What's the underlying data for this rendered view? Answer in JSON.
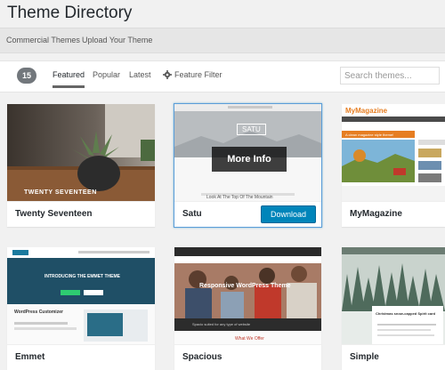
{
  "page": {
    "title": "Theme Directory"
  },
  "subnav": {
    "items": [
      "Commercial Themes",
      "Upload Your Theme"
    ]
  },
  "filter_bar": {
    "count": "15",
    "tabs": [
      {
        "label": "Featured",
        "active": true
      },
      {
        "label": "Popular",
        "active": false
      },
      {
        "label": "Latest",
        "active": false
      }
    ],
    "feature_filter": "Feature Filter",
    "search_placeholder": "Search themes..."
  },
  "themes": [
    {
      "name": "Twenty Seventeen",
      "screenshot_text": "TWENTY SEVENTEEN"
    },
    {
      "name": "Satu",
      "screenshot_title": "SATU",
      "screenshot_caption": "Look At The Top Of The Mountain",
      "more_info": "More Info",
      "download": "Download"
    },
    {
      "name": "MyMagazine",
      "screenshot_title": "MyMagazine",
      "screenshot_banner": "A clean magazine style theme!"
    },
    {
      "name": "Emmet",
      "screenshot_heading": "INTRODUCING THE EMMET THEME",
      "screenshot_sub": "WordPress Customizer"
    },
    {
      "name": "Spacious",
      "screenshot_heading": "Responsive WordPress Theme",
      "screenshot_sub": "Spacio suited for any type of website",
      "screenshot_footer": "What We Offer"
    },
    {
      "name": "Simple",
      "screenshot_text": "Christmas snow-capped Spirit card"
    }
  ],
  "colors": {
    "primary_button": "#0085ba",
    "focus_ring": "#5b9dd9",
    "count_badge": "#72777c"
  }
}
